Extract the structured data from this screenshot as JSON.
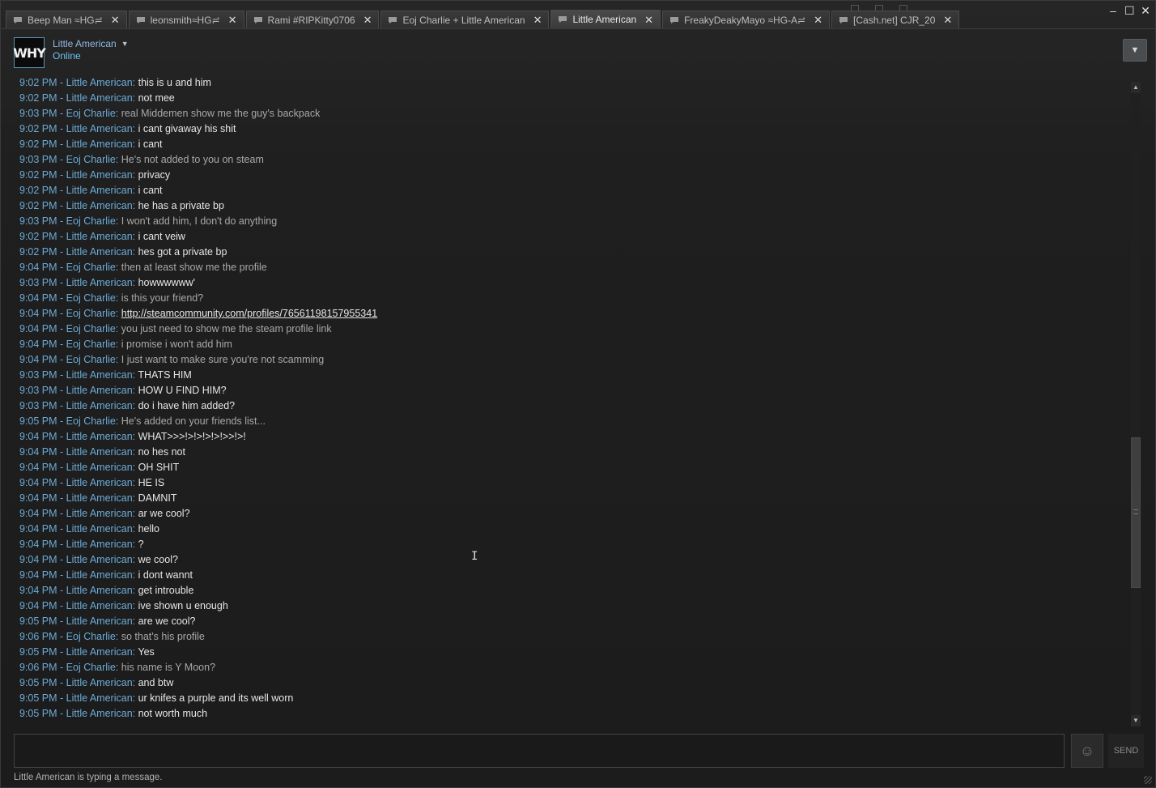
{
  "tabs": [
    {
      "label": "Beep Man ≈HG≓",
      "active": false
    },
    {
      "label": "leonsmith≈HG≓",
      "active": false
    },
    {
      "label": "Rami #RIPKitty0706",
      "active": false
    },
    {
      "label": "Eoj Charlie + Little American",
      "active": false
    },
    {
      "label": "Little American",
      "active": true
    },
    {
      "label": "FreakyDeakyMayo ≈HG-A≓",
      "active": false
    },
    {
      "label": "[Cash.net] CJR_20",
      "active": false
    }
  ],
  "window_controls": {
    "minimize": "–",
    "maximize": "☐",
    "close": "✕"
  },
  "header": {
    "avatar_text": "WHY",
    "username": "Little American",
    "status": "Online",
    "status_color": "#6dc1f0"
  },
  "messages": [
    {
      "time": "9:02 PM",
      "sender": "Little American",
      "text": "this is u and him",
      "me": true
    },
    {
      "time": "9:02 PM",
      "sender": "Little American",
      "text": "not mee",
      "me": true
    },
    {
      "time": "9:03 PM",
      "sender": "Eoj Charlie",
      "text": "real Middemen show me the guy's backpack",
      "me": false
    },
    {
      "time": "9:02 PM",
      "sender": "Little American",
      "text": "i cant givaway his shit",
      "me": true
    },
    {
      "time": "9:02 PM",
      "sender": "Little American",
      "text": "i cant",
      "me": true
    },
    {
      "time": "9:03 PM",
      "sender": "Eoj Charlie",
      "text": "He's not added to you on steam",
      "me": false
    },
    {
      "time": "9:02 PM",
      "sender": "Little American",
      "text": "privacy",
      "me": true
    },
    {
      "time": "9:02 PM",
      "sender": "Little American",
      "text": "i cant",
      "me": true
    },
    {
      "time": "9:02 PM",
      "sender": "Little American",
      "text": "he has a private bp",
      "me": true
    },
    {
      "time": "9:03 PM",
      "sender": "Eoj Charlie",
      "text": "I won't add him, I don't do anything",
      "me": false
    },
    {
      "time": "9:02 PM",
      "sender": "Little American",
      "text": "i cant veiw",
      "me": true
    },
    {
      "time": "9:02 PM",
      "sender": "Little American",
      "text": "hes got a private bp",
      "me": true
    },
    {
      "time": "9:04 PM",
      "sender": "Eoj Charlie",
      "text": "then at least show me the profile",
      "me": false
    },
    {
      "time": "9:03 PM",
      "sender": "Little American",
      "text": "howwwwww'",
      "me": true
    },
    {
      "time": "9:04 PM",
      "sender": "Eoj Charlie",
      "text": "is this your friend?",
      "me": false
    },
    {
      "time": "9:04 PM",
      "sender": "Eoj Charlie",
      "text": "http://steamcommunity.com/profiles/76561198157955341",
      "me": false,
      "link": true
    },
    {
      "time": "9:04 PM",
      "sender": "Eoj Charlie",
      "text": "you just need to show me the steam profile link",
      "me": false
    },
    {
      "time": "9:04 PM",
      "sender": "Eoj Charlie",
      "text": "i promise i won't add him",
      "me": false
    },
    {
      "time": "9:04 PM",
      "sender": "Eoj Charlie",
      "text": "I just want to make sure you're not scamming",
      "me": false
    },
    {
      "time": "9:03 PM",
      "sender": "Little American",
      "text": "THATS HIM",
      "me": true
    },
    {
      "time": "9:03 PM",
      "sender": "Little American",
      "text": "HOW U FIND HIM?",
      "me": true
    },
    {
      "time": "9:03 PM",
      "sender": "Little American",
      "text": "do i have him added?",
      "me": true
    },
    {
      "time": "9:05 PM",
      "sender": "Eoj Charlie",
      "text": "He's added on your friends list...",
      "me": false
    },
    {
      "time": "9:04 PM",
      "sender": "Little American",
      "text": "WHAT>>>!>!>!>!>!>>!>!",
      "me": true
    },
    {
      "time": "9:04 PM",
      "sender": "Little American",
      "text": "no hes not",
      "me": true
    },
    {
      "time": "9:04 PM",
      "sender": "Little American",
      "text": "OH SHIT",
      "me": true
    },
    {
      "time": "9:04 PM",
      "sender": "Little American",
      "text": "HE IS",
      "me": true
    },
    {
      "time": "9:04 PM",
      "sender": "Little American",
      "text": "DAMNIT",
      "me": true
    },
    {
      "time": "9:04 PM",
      "sender": "Little American",
      "text": "ar we cool?",
      "me": true
    },
    {
      "time": "9:04 PM",
      "sender": "Little American",
      "text": "hello",
      "me": true
    },
    {
      "time": "9:04 PM",
      "sender": "Little American",
      "text": "?",
      "me": true
    },
    {
      "time": "9:04 PM",
      "sender": "Little American",
      "text": "we cool?",
      "me": true
    },
    {
      "time": "9:04 PM",
      "sender": "Little American",
      "text": "i dont wannt",
      "me": true
    },
    {
      "time": "9:04 PM",
      "sender": "Little American",
      "text": "get introuble",
      "me": true
    },
    {
      "time": "9:04 PM",
      "sender": "Little American",
      "text": "ive shown u enough",
      "me": true
    },
    {
      "time": "9:05 PM",
      "sender": "Little American",
      "text": "are we cool?",
      "me": true
    },
    {
      "time": "9:06 PM",
      "sender": "Eoj Charlie",
      "text": "so that's his profile",
      "me": false
    },
    {
      "time": "9:05 PM",
      "sender": "Little American",
      "text": "Yes",
      "me": true
    },
    {
      "time": "9:06 PM",
      "sender": "Eoj Charlie",
      "text": "his name is Y Moon?",
      "me": false
    },
    {
      "time": "9:05 PM",
      "sender": "Little American",
      "text": "and btw",
      "me": true
    },
    {
      "time": "9:05 PM",
      "sender": "Little American",
      "text": "ur knifes a purple and its well worn",
      "me": true
    },
    {
      "time": "9:05 PM",
      "sender": "Little American",
      "text": "not worth much",
      "me": true
    }
  ],
  "scrollbar": {
    "position_fraction": 0.73
  },
  "composer": {
    "value": "",
    "send_label": "SEND"
  },
  "typing_status": "Little American is typing a message."
}
